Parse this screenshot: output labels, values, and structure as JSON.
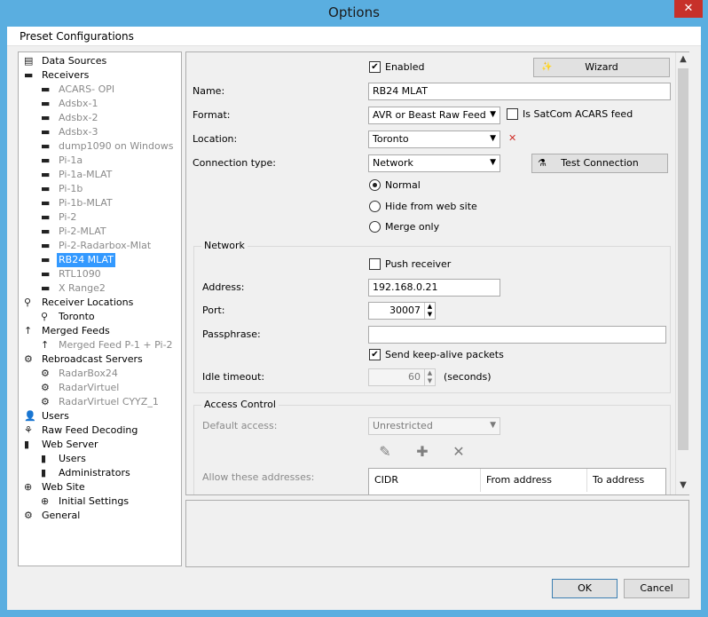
{
  "window": {
    "title": "Options",
    "close_glyph": "✕"
  },
  "menu": {
    "preset_configurations": "Preset Configurations"
  },
  "tree": [
    {
      "label": "Data Sources",
      "icon": "data-sources-icon",
      "level": 0,
      "dim": false,
      "selected": false
    },
    {
      "label": "Receivers",
      "icon": "receiver-icon",
      "level": 0,
      "dim": false,
      "selected": false
    },
    {
      "label": "ACARS- OPI",
      "icon": "receiver-icon",
      "level": 1,
      "dim": true,
      "selected": false
    },
    {
      "label": "Adsbx-1",
      "icon": "receiver-icon",
      "level": 1,
      "dim": true,
      "selected": false
    },
    {
      "label": "Adsbx-2",
      "icon": "receiver-icon",
      "level": 1,
      "dim": true,
      "selected": false
    },
    {
      "label": "Adsbx-3",
      "icon": "receiver-icon",
      "level": 1,
      "dim": true,
      "selected": false
    },
    {
      "label": "dump1090 on Windows",
      "icon": "receiver-icon",
      "level": 1,
      "dim": true,
      "selected": false
    },
    {
      "label": "Pi-1a",
      "icon": "receiver-icon",
      "level": 1,
      "dim": true,
      "selected": false
    },
    {
      "label": "Pi-1a-MLAT",
      "icon": "receiver-icon",
      "level": 1,
      "dim": true,
      "selected": false
    },
    {
      "label": "Pi-1b",
      "icon": "receiver-icon",
      "level": 1,
      "dim": true,
      "selected": false
    },
    {
      "label": "Pi-1b-MLAT",
      "icon": "receiver-icon",
      "level": 1,
      "dim": true,
      "selected": false
    },
    {
      "label": "Pi-2",
      "icon": "receiver-icon",
      "level": 1,
      "dim": true,
      "selected": false
    },
    {
      "label": "Pi-2-MLAT",
      "icon": "receiver-icon",
      "level": 1,
      "dim": true,
      "selected": false
    },
    {
      "label": "Pi-2-Radarbox-Mlat",
      "icon": "receiver-icon",
      "level": 1,
      "dim": true,
      "selected": false
    },
    {
      "label": "RB24 MLAT",
      "icon": "receiver-icon",
      "level": 1,
      "dim": false,
      "selected": true
    },
    {
      "label": "RTL1090",
      "icon": "receiver-icon",
      "level": 1,
      "dim": true,
      "selected": false
    },
    {
      "label": "X Range2",
      "icon": "receiver-icon",
      "level": 1,
      "dim": true,
      "selected": false
    },
    {
      "label": "Receiver Locations",
      "icon": "location-pin-icon",
      "level": 0,
      "dim": false,
      "selected": false
    },
    {
      "label": "Toronto",
      "icon": "location-pin-icon",
      "level": 1,
      "dim": false,
      "selected": false
    },
    {
      "label": "Merged Feeds",
      "icon": "merge-arrow-icon",
      "level": 0,
      "dim": false,
      "selected": false
    },
    {
      "label": "Merged Feed P-1 + Pi-2",
      "icon": "merge-arrow-icon",
      "level": 1,
      "dim": true,
      "selected": false
    },
    {
      "label": "Rebroadcast Servers",
      "icon": "rebroadcast-icon",
      "level": 0,
      "dim": false,
      "selected": false
    },
    {
      "label": "RadarBox24",
      "icon": "rebroadcast-icon",
      "level": 1,
      "dim": true,
      "selected": false
    },
    {
      "label": "RadarVirtuel",
      "icon": "rebroadcast-icon",
      "level": 1,
      "dim": true,
      "selected": false
    },
    {
      "label": "RadarVirtuel CYYZ_1",
      "icon": "rebroadcast-icon",
      "level": 1,
      "dim": true,
      "selected": false
    },
    {
      "label": "Users",
      "icon": "users-icon",
      "level": 0,
      "dim": false,
      "selected": false
    },
    {
      "label": "Raw Feed Decoding",
      "icon": "raw-feed-icon",
      "level": 0,
      "dim": false,
      "selected": false
    },
    {
      "label": "Web Server",
      "icon": "server-icon",
      "level": 0,
      "dim": false,
      "selected": false
    },
    {
      "label": "Users",
      "icon": "server-icon",
      "level": 1,
      "dim": false,
      "selected": false
    },
    {
      "label": "Administrators",
      "icon": "server-icon",
      "level": 1,
      "dim": false,
      "selected": false
    },
    {
      "label": "Web Site",
      "icon": "globe-icon",
      "level": 0,
      "dim": false,
      "selected": false
    },
    {
      "label": "Initial Settings",
      "icon": "globe-icon",
      "level": 1,
      "dim": false,
      "selected": false
    },
    {
      "label": "General",
      "icon": "gear-icon",
      "level": 0,
      "dim": false,
      "selected": false
    }
  ],
  "receiver": {
    "enabled_label": "Enabled",
    "enabled": true,
    "wizard_label": "Wizard",
    "name_label": "Name:",
    "name_value": "RB24 MLAT",
    "format_label": "Format:",
    "format_value": "AVR or Beast Raw Feed",
    "satcom_label": "Is SatCom ACARS feed",
    "satcom": false,
    "location_label": "Location:",
    "location_value": "Toronto",
    "location_clear_glyph": "✕",
    "connection_type_label": "Connection type:",
    "connection_type_value": "Network",
    "test_connection_label": "Test Connection",
    "radio_normal": "Normal",
    "radio_hide": "Hide from web site",
    "radio_merge": "Merge only",
    "selected_mode": "Normal"
  },
  "network": {
    "group_title": "Network",
    "push_receiver_label": "Push receiver",
    "push_receiver": false,
    "address_label": "Address:",
    "address_value": "192.168.0.21",
    "port_label": "Port:",
    "port_value": "30007",
    "passphrase_label": "Passphrase:",
    "passphrase_value": "",
    "keepalive_label": "Send keep-alive packets",
    "keepalive": true,
    "idle_timeout_label": "Idle timeout:",
    "idle_timeout_value": "60",
    "idle_timeout_unit": "(seconds)"
  },
  "access": {
    "group_title": "Access Control",
    "default_access_label": "Default access:",
    "default_access_value": "Unrestricted",
    "allow_label": "Allow these addresses:",
    "columns": [
      "CIDR",
      "From address",
      "To address"
    ],
    "edit_icon": "pencil-icon",
    "add_icon": "plus-icon",
    "delete_icon": "x-icon"
  },
  "footer": {
    "ok_label": "OK",
    "cancel_label": "Cancel"
  },
  "colors": {
    "titlebar": "#5aaee0",
    "selection": "#3399ff",
    "close": "#c7312a",
    "error_x": "#d0302a"
  }
}
